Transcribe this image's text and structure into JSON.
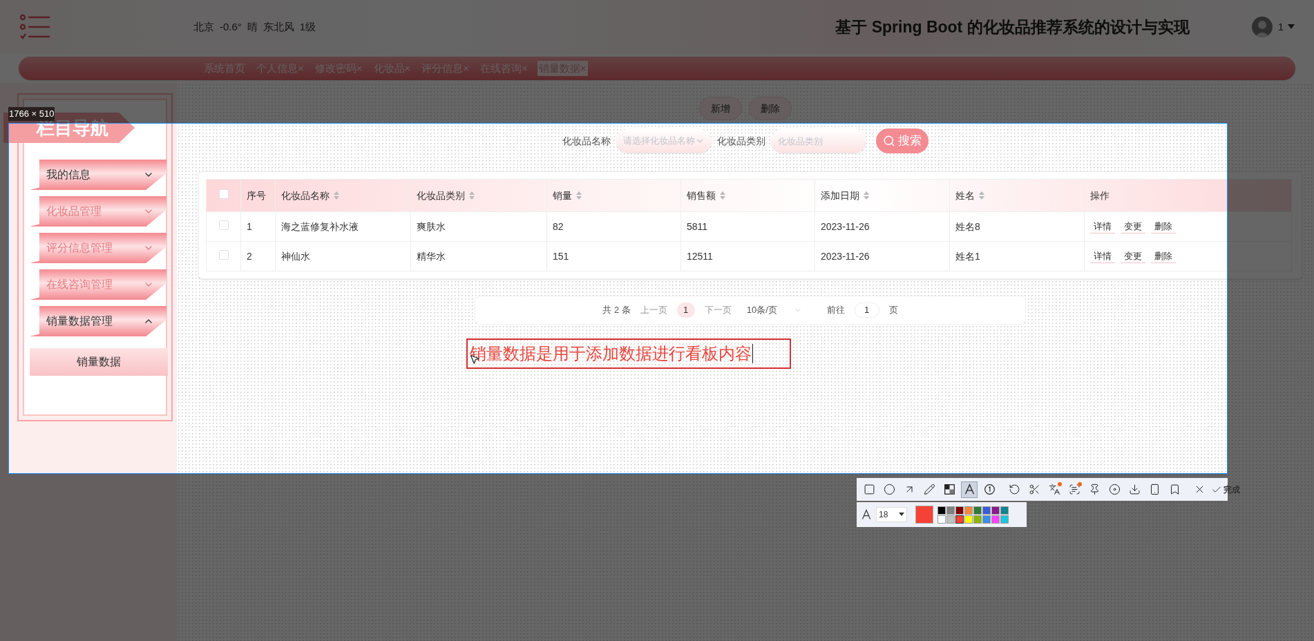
{
  "header": {
    "weather": [
      "北京",
      "-0.6°",
      "晴",
      "东北风",
      "1级"
    ],
    "title": "基于 Spring Boot 的化妆品推荐系统的设计与实现",
    "user": "1"
  },
  "tabs": [
    {
      "label": "系统首页",
      "selected": false
    },
    {
      "label": "个人信息",
      "close_mark": "×",
      "selected": false
    },
    {
      "label": "修改密码",
      "close_mark": "×",
      "selected": false
    },
    {
      "label": "化妆品",
      "close_mark": "×",
      "selected": false
    },
    {
      "label": "评分信息",
      "close_mark": "×",
      "selected": false
    },
    {
      "label": "在线咨询",
      "close_mark": "×",
      "selected": false
    },
    {
      "label": "销量数据",
      "close_mark": "×",
      "selected": true
    }
  ],
  "sidebar": {
    "title": "栏目导航",
    "items": [
      {
        "label": "我的信息",
        "active": true,
        "expanded": false
      },
      {
        "label": "化妆品管理",
        "active": false,
        "expanded": false
      },
      {
        "label": "评分信息管理",
        "active": false,
        "expanded": false
      },
      {
        "label": "在线咨询管理",
        "active": false,
        "expanded": false
      },
      {
        "label": "销量数据管理",
        "active": true,
        "expanded": true,
        "children": [
          {
            "label": "销量数据",
            "selected": true
          }
        ]
      }
    ]
  },
  "actions": [
    "新增",
    "删除"
  ],
  "search": {
    "fields": [
      {
        "label": "化妆品名称",
        "placeholder": "请选择化妆品名称",
        "kind": "select"
      },
      {
        "label": "化妆品类别",
        "placeholder": "化妆品类别",
        "kind": "input"
      }
    ],
    "button": "搜索"
  },
  "table": {
    "select_all_checked": false,
    "columns": [
      {
        "label": "序号",
        "sortable": false
      },
      {
        "label": "化妆品名称",
        "sortable": true
      },
      {
        "label": "化妆品类别",
        "sortable": true
      },
      {
        "label": "销量",
        "sortable": true
      },
      {
        "label": "销售额",
        "sortable": true
      },
      {
        "label": "添加日期",
        "sortable": true
      },
      {
        "label": "姓名",
        "sortable": true
      },
      {
        "label": "操作",
        "sortable": false
      }
    ],
    "rows": [
      {
        "checked": false,
        "cells": [
          "1",
          "海之蓝修复补水液",
          "爽肤水",
          "82",
          "5811",
          "2023-11-26",
          "姓名8"
        ],
        "actions": [
          "详情",
          "变更",
          "删除"
        ]
      },
      {
        "checked": false,
        "cells": [
          "2",
          "神仙水",
          "精华水",
          "151",
          "12511",
          "2023-11-26",
          "姓名1"
        ],
        "actions": [
          "详情",
          "变更",
          "删除"
        ]
      }
    ]
  },
  "pagination": {
    "total": "共 2 条",
    "prev": "上一页",
    "pages": [
      {
        "label": "1",
        "selected": true
      }
    ],
    "next": "下一页",
    "page_size": "10条/页",
    "goto": "前往",
    "goto_value": "1",
    "goto_unit": "页"
  },
  "annotation": {
    "text": "销量数据是用于添加数据进行看板内容"
  },
  "capture_tool": {
    "size_label": "1766 × 510",
    "tools": [
      {
        "kind": "rectangle",
        "selected": false,
        "badge": false
      },
      {
        "kind": "ellipse",
        "selected": false,
        "badge": false
      },
      {
        "kind": "arrow",
        "selected": false,
        "badge": false
      },
      {
        "kind": "pencil",
        "selected": false,
        "badge": false
      },
      {
        "kind": "mosaic",
        "selected": false,
        "badge": false
      },
      {
        "kind": "text",
        "selected": true,
        "badge": false
      },
      {
        "kind": "number",
        "selected": false,
        "badge": false
      },
      {
        "kind": "separator"
      },
      {
        "kind": "undo",
        "selected": false,
        "badge": false
      },
      {
        "kind": "cut",
        "selected": false,
        "badge": false
      },
      {
        "kind": "translate",
        "selected": false,
        "badge": true
      },
      {
        "kind": "ocr",
        "selected": false,
        "badge": true
      },
      {
        "kind": "pin",
        "selected": false,
        "badge": false
      },
      {
        "kind": "record",
        "selected": false,
        "badge": false
      },
      {
        "kind": "save",
        "selected": false,
        "badge": false
      },
      {
        "kind": "phone",
        "selected": false,
        "badge": false
      },
      {
        "kind": "bookmark",
        "selected": false,
        "badge": false
      },
      {
        "kind": "separator"
      },
      {
        "kind": "close",
        "selected": false,
        "badge": false
      }
    ],
    "finish": "完成",
    "font_size": "18",
    "palette": [
      {
        "color": "#000000",
        "selected": false
      },
      {
        "color": "#808080",
        "selected": false
      },
      {
        "color": "#800000",
        "selected": false
      },
      {
        "color": "#f7883a",
        "selected": false
      },
      {
        "color": "#2e7d32",
        "selected": false
      },
      {
        "color": "#3b5bdb",
        "selected": false
      },
      {
        "color": "#8b1a8b",
        "selected": false
      },
      {
        "color": "#0f8590",
        "selected": false
      },
      {
        "color": "#ffffff",
        "selected": false
      },
      {
        "color": "#c0c0c0",
        "selected": false
      },
      {
        "color": "#f44336",
        "selected": true
      },
      {
        "color": "#ffff00",
        "selected": false
      },
      {
        "color": "#8db600",
        "selected": false
      },
      {
        "color": "#3a8ee6",
        "selected": false
      },
      {
        "color": "#ff40ff",
        "selected": false
      },
      {
        "color": "#1cc7dc",
        "selected": false
      }
    ]
  }
}
